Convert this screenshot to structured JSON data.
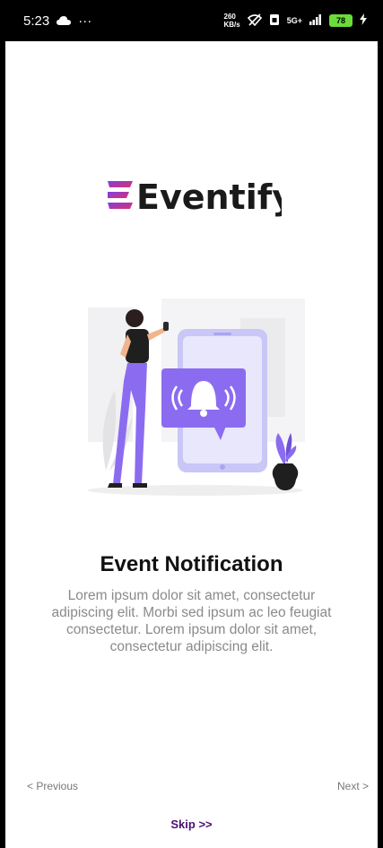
{
  "status_bar": {
    "time": "5:23",
    "dots": "···",
    "net_speed_value": "260",
    "net_speed_unit": "KB/s",
    "network": "5G+",
    "battery": "78",
    "icons": [
      "cloud-icon",
      "wifi-off-icon",
      "sim-icon",
      "signal-icon",
      "battery-icon",
      "charging-icon"
    ]
  },
  "brand": {
    "name": "Eventify",
    "colors": {
      "gradient_start": "#7b3fe4",
      "gradient_end": "#e0306a",
      "text": "#1a1a1a"
    }
  },
  "slide": {
    "title": "Event Notification",
    "description": "Lorem ipsum dolor sit amet, consectetur adipiscing elit. Morbi sed ipsum ac leo feugiat consectetur. Lorem ipsum dolor sit amet, consectetur adipiscing elit."
  },
  "nav": {
    "previous_label": "< Previous",
    "next_label": "Next >",
    "skip_label": "Skip >>"
  },
  "colors": {
    "accent": "#8b6cf0",
    "skip": "#4a1070"
  }
}
